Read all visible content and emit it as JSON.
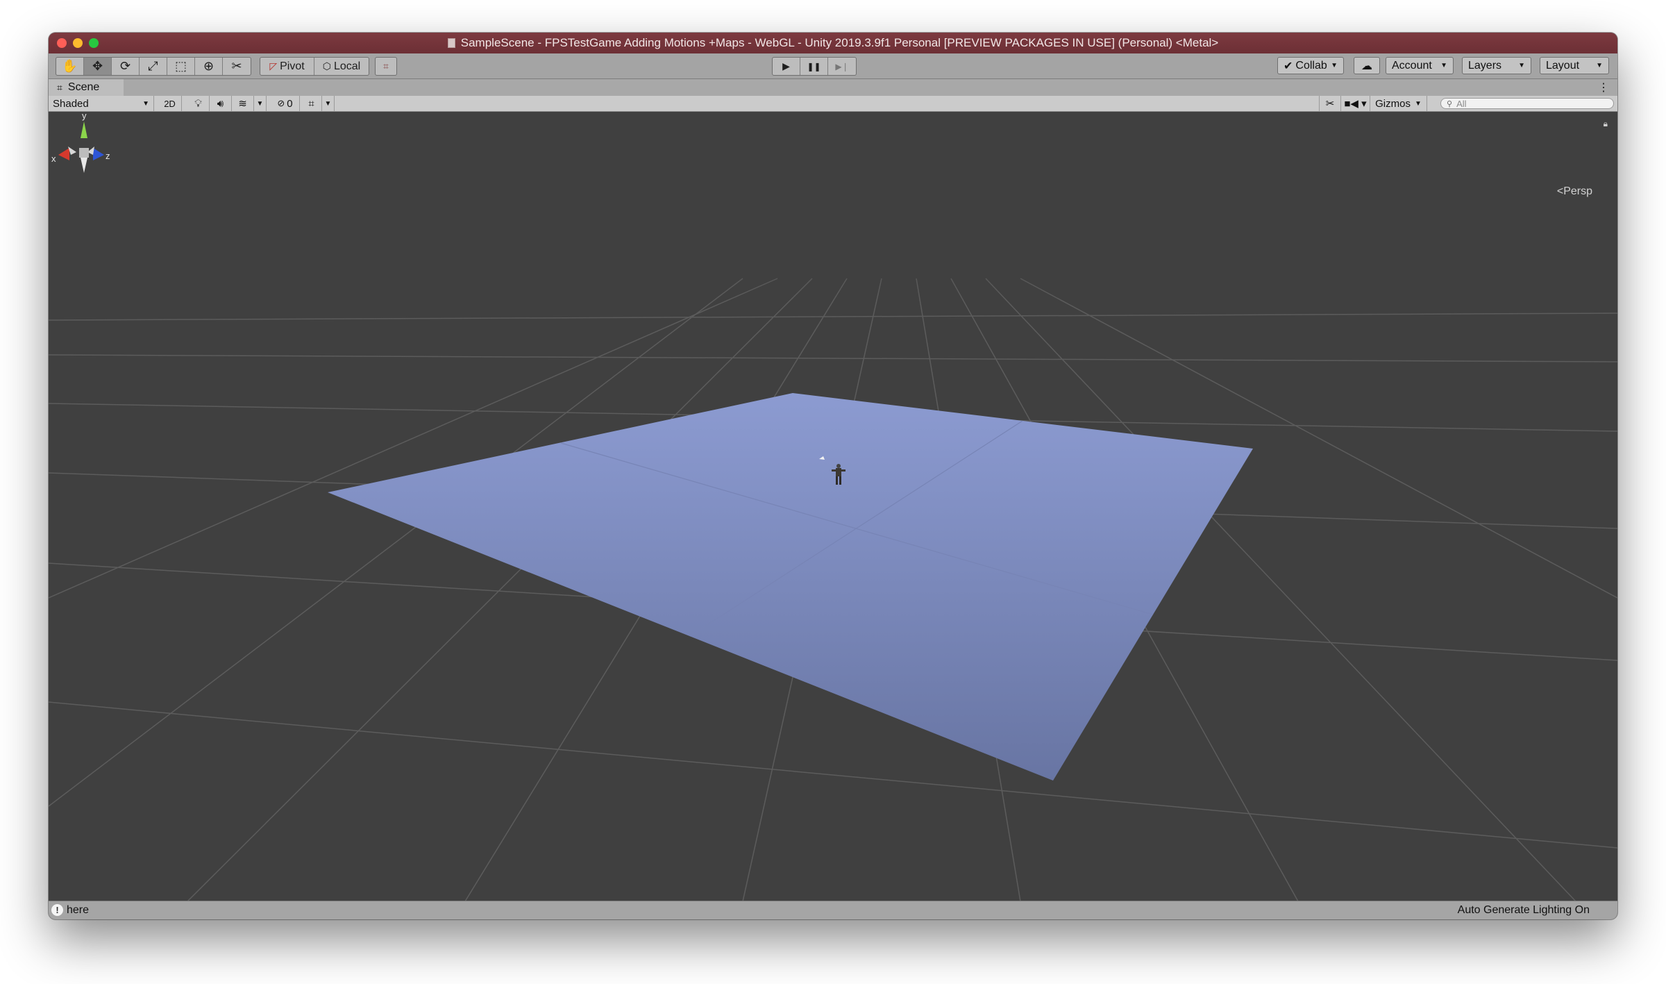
{
  "window": {
    "title": "SampleScene - FPSTestGame Adding Motions +Maps - WebGL - Unity 2019.3.9f1 Personal [PREVIEW PACKAGES IN USE] (Personal) <Metal>"
  },
  "toolbar": {
    "tools": [
      {
        "name": "hand-tool",
        "glyph": "✋"
      },
      {
        "name": "move-tool",
        "glyph": "✥"
      },
      {
        "name": "rotate-tool",
        "glyph": "⟳"
      },
      {
        "name": "scale-tool",
        "glyph": "⤢"
      },
      {
        "name": "rect-tool",
        "glyph": "⬚"
      },
      {
        "name": "transform-tool",
        "glyph": "⊕"
      },
      {
        "name": "custom-tool",
        "glyph": "✂"
      }
    ],
    "pivot_label": "Pivot",
    "local_label": "Local",
    "play_glyph": "▶",
    "pause_glyph": "❚❚",
    "step_glyph": "▶❘",
    "collab_label": "Collab",
    "account_label": "Account",
    "layers_label": "Layers",
    "layout_label": "Layout"
  },
  "scene_tab": {
    "label": "Scene",
    "menu_glyph": "⋮"
  },
  "scene_toolbar": {
    "shading_mode": "Shaded",
    "toggle_2d": "2D",
    "hidden_count": "0",
    "gizmos_label": "Gizmos",
    "search_placeholder": "All"
  },
  "viewport": {
    "projection_label": "Persp",
    "axis_x": "x",
    "axis_y": "y",
    "axis_z": "z",
    "plane_color": "#8796cc",
    "background_color": "#404040"
  },
  "statusbar": {
    "message": "here",
    "right_text": "Auto Generate Lighting On"
  }
}
